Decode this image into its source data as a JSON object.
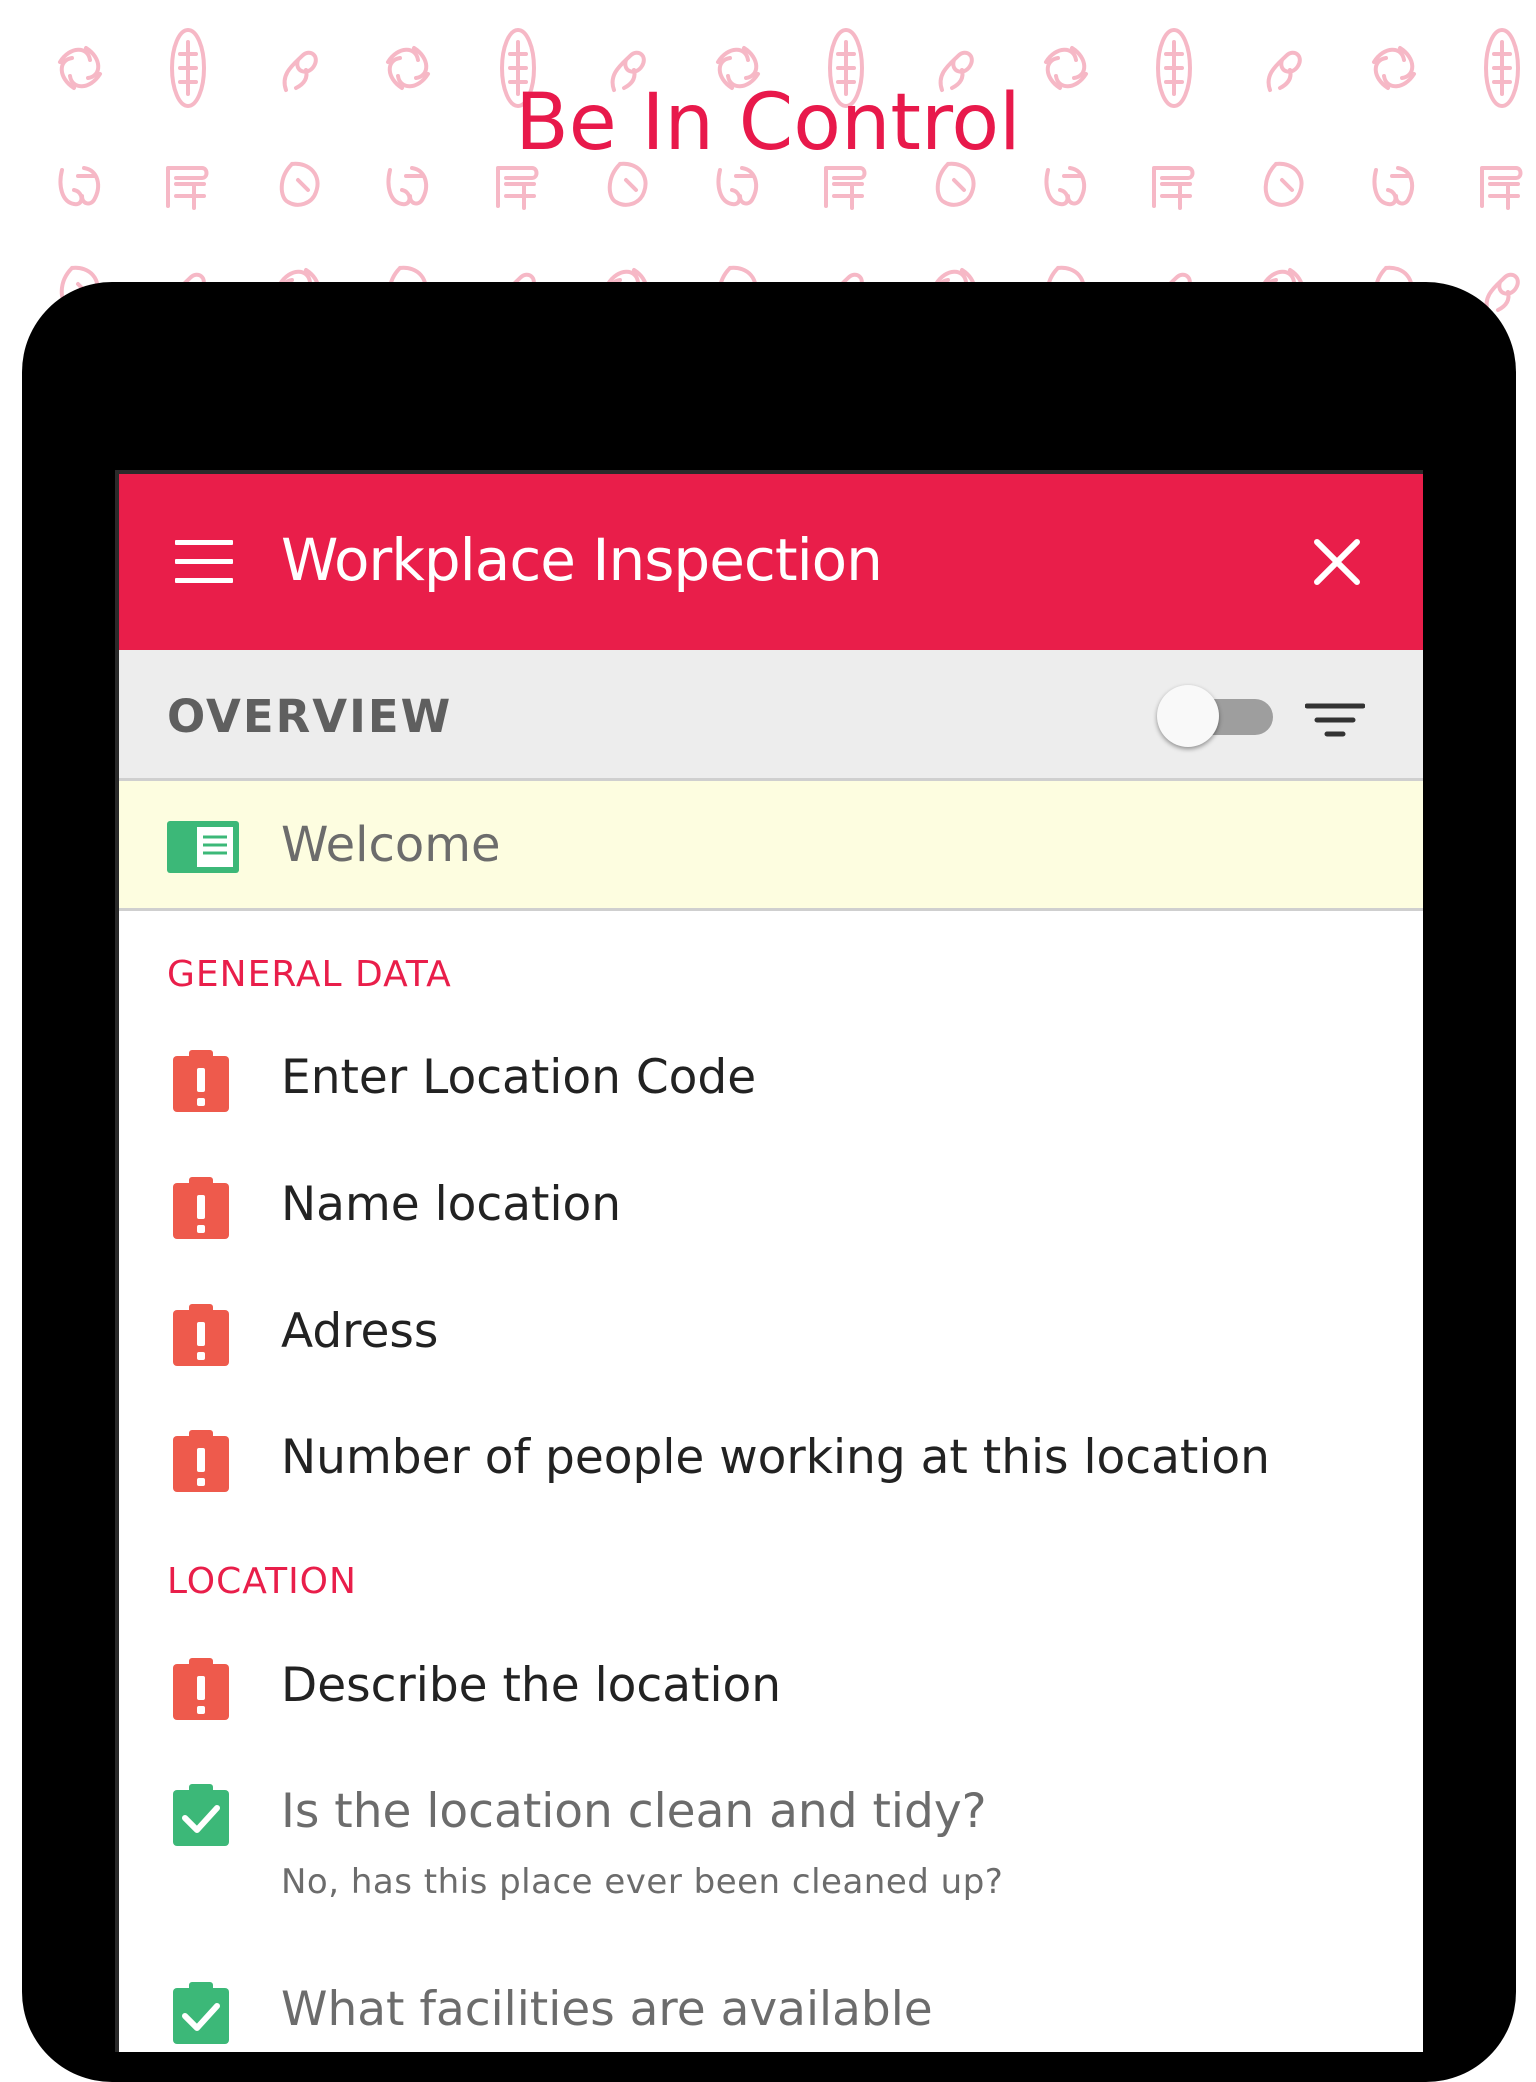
{
  "headline": "Be In Control",
  "colors": {
    "accent": "#e91e4a",
    "warning": "#ee5a4c",
    "success": "#3cb878",
    "highlight": "#fdfde0"
  },
  "appbar": {
    "title": "Workplace Inspection",
    "menu_icon": "hamburger-menu-icon",
    "close_icon": "close-icon"
  },
  "overview": {
    "label": "OVERVIEW",
    "toggle_on": false,
    "filter_icon": "filter-icon"
  },
  "welcome": {
    "label": "Welcome",
    "icon": "document-icon"
  },
  "sections": [
    {
      "title": "GENERAL DATA",
      "items": [
        {
          "label": "Enter Location Code",
          "status": "required",
          "icon": "clipboard-alert-icon"
        },
        {
          "label": "Name location",
          "status": "required",
          "icon": "clipboard-alert-icon"
        },
        {
          "label": "Adress",
          "status": "required",
          "icon": "clipboard-alert-icon"
        },
        {
          "label": "Number of people working at this location",
          "status": "required",
          "icon": "clipboard-alert-icon"
        }
      ]
    },
    {
      "title": "LOCATION",
      "items": [
        {
          "label": "Describe the location",
          "status": "required",
          "icon": "clipboard-alert-icon"
        },
        {
          "label": "Is the location clean and tidy?",
          "status": "done",
          "icon": "clipboard-check-icon",
          "answer": "No, has this place ever been cleaned up?"
        },
        {
          "label": "What facilities are available",
          "status": "done",
          "icon": "clipboard-check-icon"
        }
      ]
    }
  ]
}
